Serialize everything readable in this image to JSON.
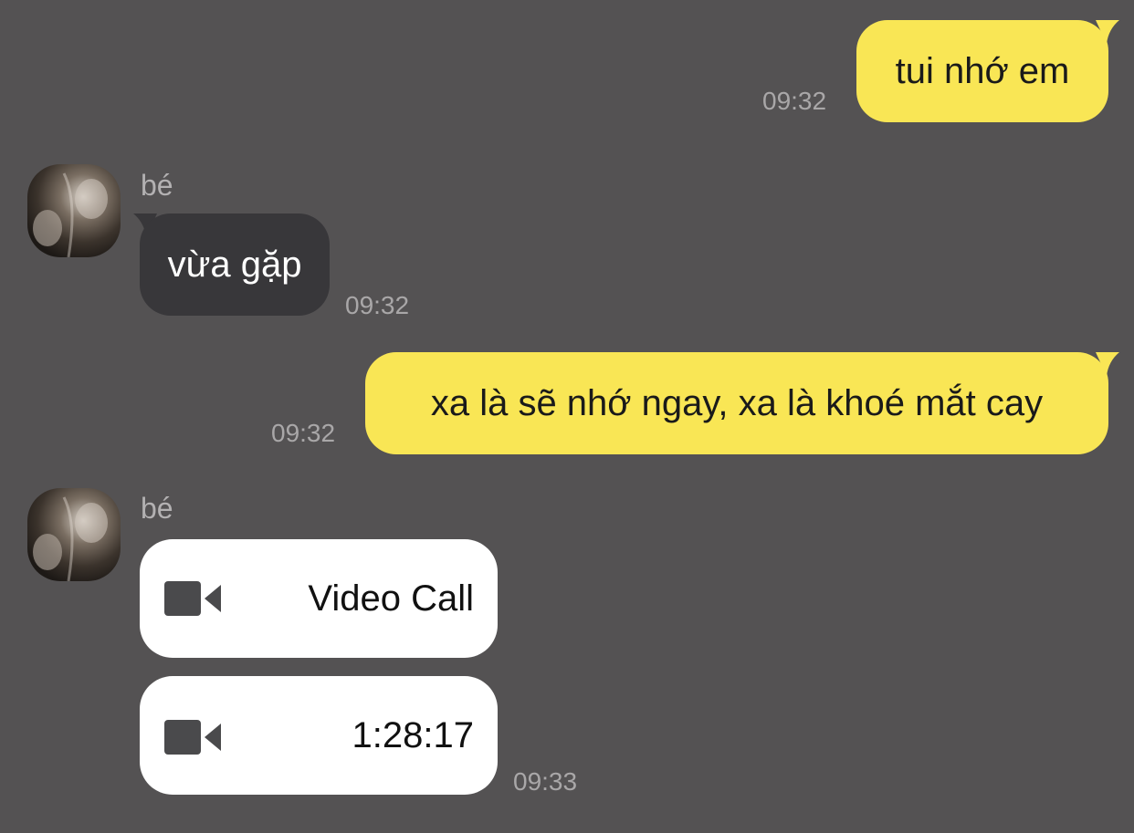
{
  "messages": [
    {
      "from": "me",
      "text": "tui nhớ em",
      "time": "09:32"
    },
    {
      "from": "them",
      "sender": "bé",
      "text": "vừa gặp",
      "time": "09:32"
    },
    {
      "from": "me",
      "text": "xa là sẽ nhớ ngay, xa là khoé mắt cay",
      "time": "09:32"
    },
    {
      "from": "them",
      "sender": "bé",
      "calls": [
        {
          "icon": "video-camera-icon",
          "label": "Video Call"
        },
        {
          "icon": "video-camera-icon",
          "label": "1:28:17"
        }
      ],
      "time": "09:33"
    }
  ],
  "colors": {
    "background": "#545253",
    "my_bubble": "#f9e655",
    "their_bubble": "#38373a",
    "call_card": "#ffffff",
    "timestamp": "#a9a7a8"
  }
}
